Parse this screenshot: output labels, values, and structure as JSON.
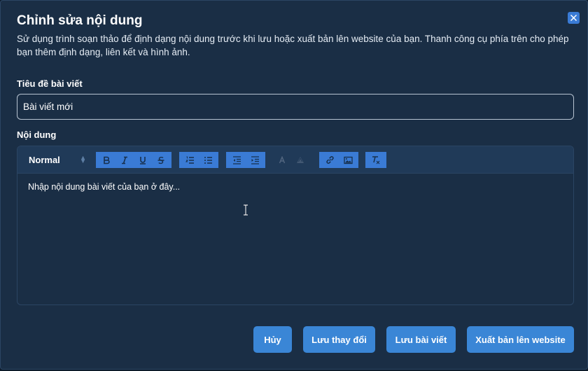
{
  "dialog": {
    "title": "Chỉnh sửa nội dung",
    "description": "Sử dụng trình soạn thảo để định dạng nội dung trước khi lưu hoặc xuất bản lên website của bạn. Thanh công cụ phía trên cho phép bạn thêm định dạng, liên kết và hình ảnh.",
    "close_icon": "close-icon"
  },
  "form": {
    "title_label": "Tiêu đề bài viết",
    "title_value": "Bài viết mới",
    "content_label": "Nội dung"
  },
  "editor": {
    "heading_select": "Normal",
    "placeholder": "Nhập nội dung bài viết của bạn ở đây...",
    "toolbar_icons": [
      "bold-icon",
      "italic-icon",
      "underline-icon",
      "strike-icon",
      "ordered-list-icon",
      "bullet-list-icon",
      "outdent-icon",
      "indent-icon",
      "text-color-icon",
      "background-color-icon",
      "link-icon",
      "image-icon",
      "clear-format-icon"
    ]
  },
  "actions": {
    "cancel": "Hủy",
    "save_changes": "Lưu thay đổi",
    "save_post": "Lưu bài viết",
    "publish": "Xuất bản lên website"
  },
  "colors": {
    "background": "#1a2e45",
    "toolbar": "#203a58",
    "accent": "#3a86d6"
  }
}
